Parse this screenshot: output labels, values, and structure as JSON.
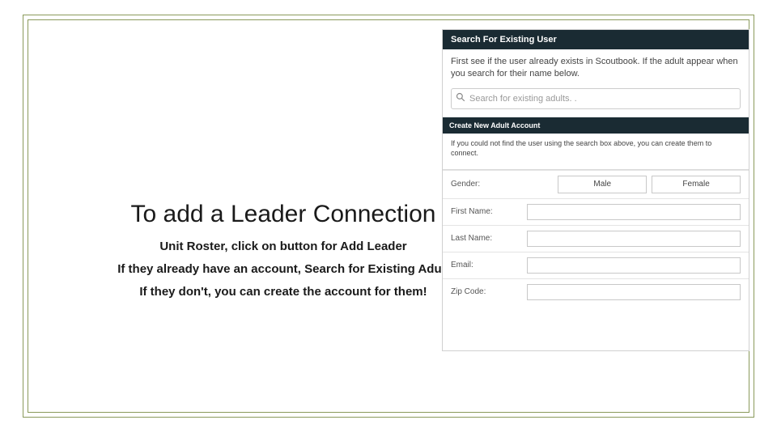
{
  "slide": {
    "heading": "To add a Leader Connection",
    "line1": "Unit Roster, click on button for Add Leader",
    "line2": "If they already have an account, Search for Existing Adult",
    "line3": "If they don't, you can create the account for them!"
  },
  "panel": {
    "search_header": "Search For Existing User",
    "search_info": "First see if the user already exists in Scoutbook. If the adult appear when you search for their name below.",
    "search_placeholder": "Search for existing adults. .",
    "create_header": "Create New Adult Account",
    "create_info": "If you could not find the user using the search box above, you can create them to connect.",
    "fields": {
      "gender_label": "Gender:",
      "male": "Male",
      "female": "Female",
      "first_name": "First Name:",
      "last_name": "Last Name:",
      "email": "Email:",
      "zip": "Zip Code:"
    }
  }
}
